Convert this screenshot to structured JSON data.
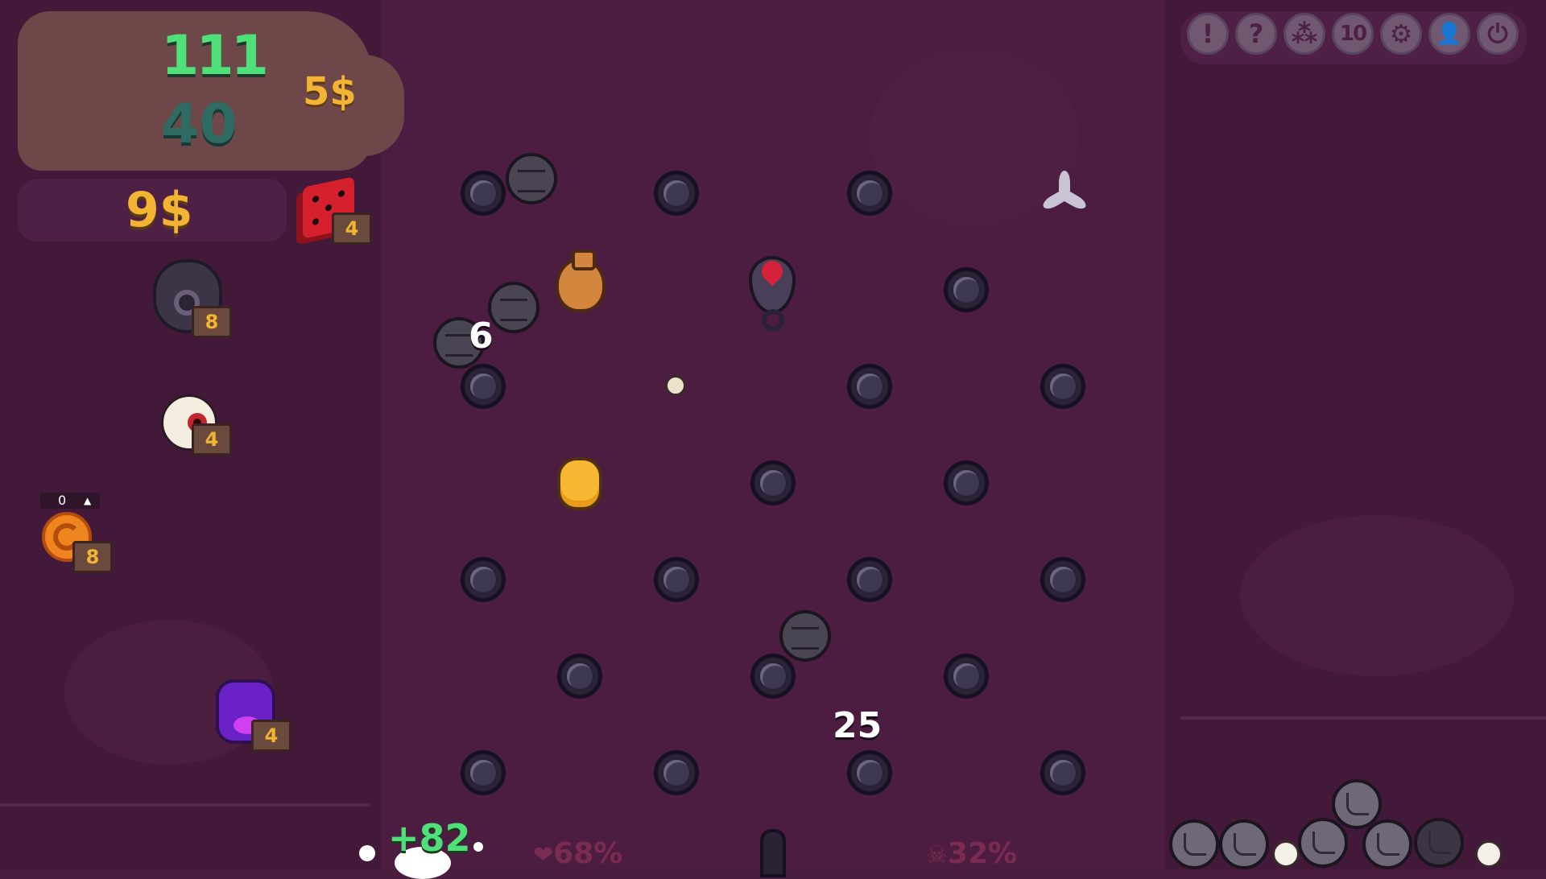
{
  "score": {
    "top_value": "111",
    "bottom_value": "40",
    "money_side": "5$"
  },
  "money": "9$",
  "relics": [
    {
      "name": "red-dice",
      "count": "4"
    },
    {
      "name": "bomb",
      "count": "8"
    },
    {
      "name": "eyeball",
      "count": "4"
    },
    {
      "name": "orange-coin",
      "count": "8",
      "counter": "0",
      "counter_arrow": "▲"
    },
    {
      "name": "purple-grape",
      "count": "4"
    }
  ],
  "board": {
    "floating_numbers": [
      "6",
      "25"
    ],
    "gain": "+82",
    "stat_left": {
      "icon": "heart-icon",
      "value": "68%"
    },
    "stat_right": {
      "icon": "skull-icon",
      "value": "32%"
    }
  },
  "toolbar": {
    "buttons": [
      {
        "name": "alert-button",
        "label": "!"
      },
      {
        "name": "help-button",
        "label": "?"
      },
      {
        "name": "balls-button",
        "label": "⁂"
      },
      {
        "name": "speed-button",
        "label": "10"
      },
      {
        "name": "settings-button",
        "label": "⚙"
      },
      {
        "name": "profile-button",
        "label": "👤"
      },
      {
        "name": "power-button",
        "label": "⏻"
      }
    ]
  },
  "colors": {
    "score_green": "#4fe07a",
    "money_gold": "#f2b432",
    "background": "#4a1c3e"
  }
}
